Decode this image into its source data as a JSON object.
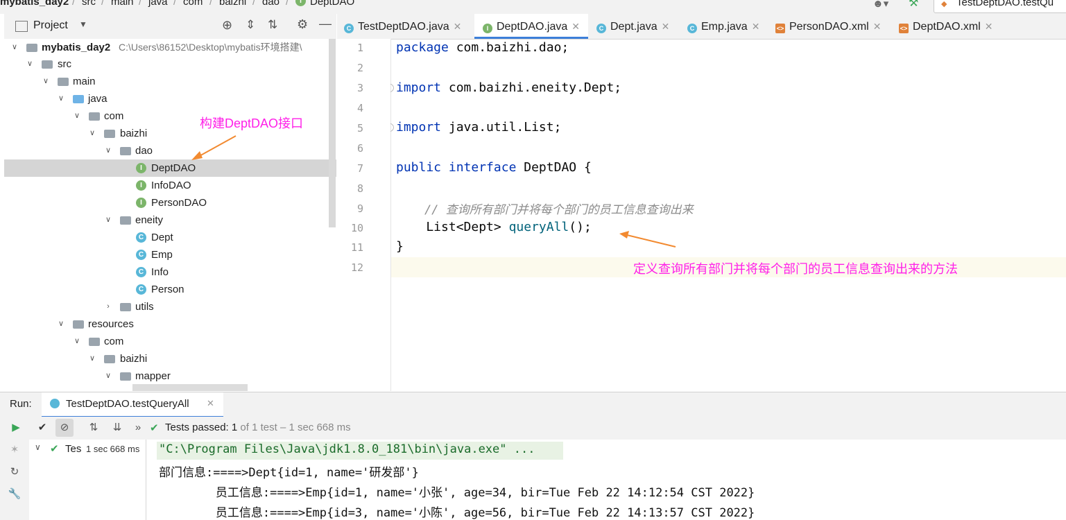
{
  "breadcrumb": [
    "mybatis_day2",
    "src",
    "main",
    "java",
    "com",
    "baizhi",
    "dao",
    "DeptDAO"
  ],
  "topright_run_config": "TestDeptDAO.testQu",
  "project_panel": {
    "title": "Project",
    "tree": [
      {
        "label": "mybatis_day2",
        "path": "C:\\Users\\86152\\Desktop\\mybatis环境搭建\\",
        "depth": 0,
        "type": "module",
        "expanded": true
      },
      {
        "label": "src",
        "depth": 1,
        "type": "folder",
        "expanded": true
      },
      {
        "label": "main",
        "depth": 2,
        "type": "folder",
        "expanded": true
      },
      {
        "label": "java",
        "depth": 3,
        "type": "source-folder",
        "expanded": true
      },
      {
        "label": "com",
        "depth": 4,
        "type": "package",
        "expanded": true
      },
      {
        "label": "baizhi",
        "depth": 5,
        "type": "package",
        "expanded": true
      },
      {
        "label": "dao",
        "depth": 6,
        "type": "package",
        "expanded": true
      },
      {
        "label": "DeptDAO",
        "depth": 7,
        "type": "interface",
        "selected": true
      },
      {
        "label": "InfoDAO",
        "depth": 7,
        "type": "interface"
      },
      {
        "label": "PersonDAO",
        "depth": 7,
        "type": "interface"
      },
      {
        "label": "eneity",
        "depth": 6,
        "type": "package",
        "expanded": true
      },
      {
        "label": "Dept",
        "depth": 7,
        "type": "class"
      },
      {
        "label": "Emp",
        "depth": 7,
        "type": "class"
      },
      {
        "label": "Info",
        "depth": 7,
        "type": "class"
      },
      {
        "label": "Person",
        "depth": 7,
        "type": "class"
      },
      {
        "label": "utils",
        "depth": 6,
        "type": "package",
        "expanded": false
      },
      {
        "label": "resources",
        "depth": 3,
        "type": "resource-folder",
        "expanded": true
      },
      {
        "label": "com",
        "depth": 4,
        "type": "package",
        "expanded": true
      },
      {
        "label": "baizhi",
        "depth": 5,
        "type": "package",
        "expanded": true
      },
      {
        "label": "mapper",
        "depth": 6,
        "type": "package",
        "expanded": true
      }
    ]
  },
  "editor_tabs": [
    {
      "label": "TestDeptDAO.java",
      "icon": "class-icon",
      "active": false
    },
    {
      "label": "DeptDAO.java",
      "icon": "interface-icon",
      "active": true
    },
    {
      "label": "Dept.java",
      "icon": "class-icon",
      "active": false
    },
    {
      "label": "Emp.java",
      "icon": "class-icon",
      "active": false
    },
    {
      "label": "PersonDAO.xml",
      "icon": "xml-icon",
      "active": false
    },
    {
      "label": "DeptDAO.xml",
      "icon": "xml-icon",
      "active": false
    }
  ],
  "line_numbers": [
    "1",
    "2",
    "3",
    "4",
    "5",
    "6",
    "7",
    "8",
    "9",
    "10",
    "11",
    "12"
  ],
  "code": {
    "l1_kw": "package",
    "l1_rest": " com.baizhi.dao;",
    "l3_kw": "import",
    "l3_rest": " com.baizhi.eneity.Dept;",
    "l5_kw": "import",
    "l5_rest": " java.util.List;",
    "l7_kw1": "public",
    "l7_kw2": "interface",
    "l7_rest": " DeptDAO {",
    "l9_comment": "    // 查询所有部门并将每个部门的员工信息查询出来",
    "l10_type": "    List<Dept> ",
    "l10_method": "queryAll",
    "l10_rest": "();",
    "l11": "}"
  },
  "annotations": {
    "tree_note": "构建DeptDAO接口",
    "code_note": "定义查询所有部门并将每个部门的员工信息查询出来的方法"
  },
  "run_panel": {
    "label": "Run:",
    "tab": "TestDeptDAO.testQueryAll",
    "status_prefix": "Tests passed:",
    "status_count": "1",
    "status_suffix": "of 1 test – 1 sec 668 ms",
    "tree_item": "Tes",
    "tree_item_time": "1 sec 668 ms",
    "console": [
      "\"C:\\Program Files\\Java\\jdk1.8.0_181\\bin\\java.exe\" ...",
      "部门信息:====>Dept{id=1, name='研发部'}",
      "        员工信息:====>Emp{id=1, name='小张', age=34, bir=Tue Feb 22 14:12:54 CST 2022}",
      "        员工信息:====>Emp{id=3, name='小陈', age=56, bir=Tue Feb 22 14:13:57 CST 2022}"
    ]
  },
  "colors": {
    "annotation": "#ff1fe8",
    "arrow": "#f28a30",
    "keyword": "#0033b3",
    "comment": "#8c8c8c",
    "method": "#00627a",
    "test_pass": "#3aa657"
  }
}
